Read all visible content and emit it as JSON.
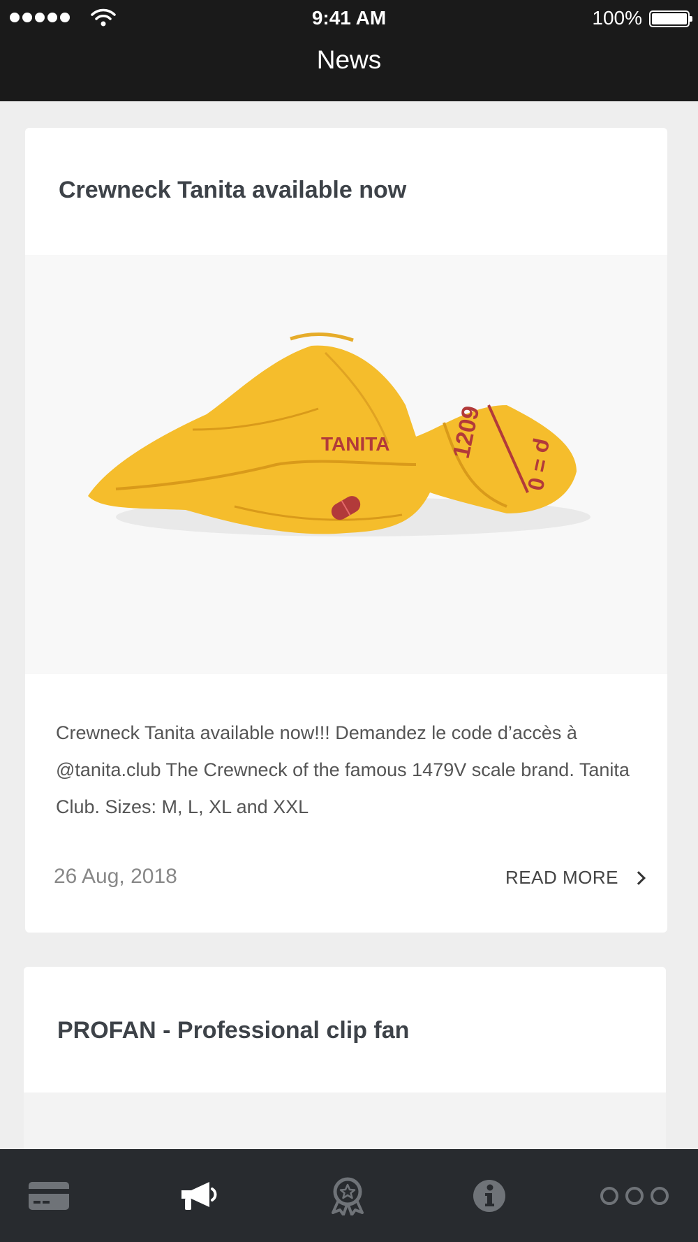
{
  "status_bar": {
    "time": "9:41 AM",
    "battery": "100%"
  },
  "header": {
    "title": "News"
  },
  "articles": [
    {
      "title": "Crewneck Tanita available now",
      "image_icon": "yellow-crewneck-sweater-photo",
      "image_text": [
        "TANITA",
        "1209",
        "ρ = 0"
      ],
      "excerpt": "Crewneck Tanita available now!!! Demandez le code d’accès à @tanita.club The Crewneck of the famous 1479V scale brand. Tanita Club. Sizes: M, L, XL and XXL",
      "date": "26 Aug, 2018",
      "read_more": "READ MORE"
    },
    {
      "title": "PROFAN - Professional clip fan"
    }
  ],
  "tab_bar": {
    "items": [
      {
        "icon": "card-icon",
        "active": false
      },
      {
        "icon": "megaphone-icon",
        "active": true
      },
      {
        "icon": "award-icon",
        "active": false
      },
      {
        "icon": "info-icon",
        "active": false
      },
      {
        "icon": "more-icon",
        "active": false
      }
    ]
  },
  "colors": {
    "header_bg": "#1a1a1a",
    "tab_bar_bg": "#282b2f",
    "tab_active": "#ffffff",
    "tab_inactive": "#6f7378",
    "sweater": "#f5bd2c",
    "print_red": "#b23a3a"
  }
}
